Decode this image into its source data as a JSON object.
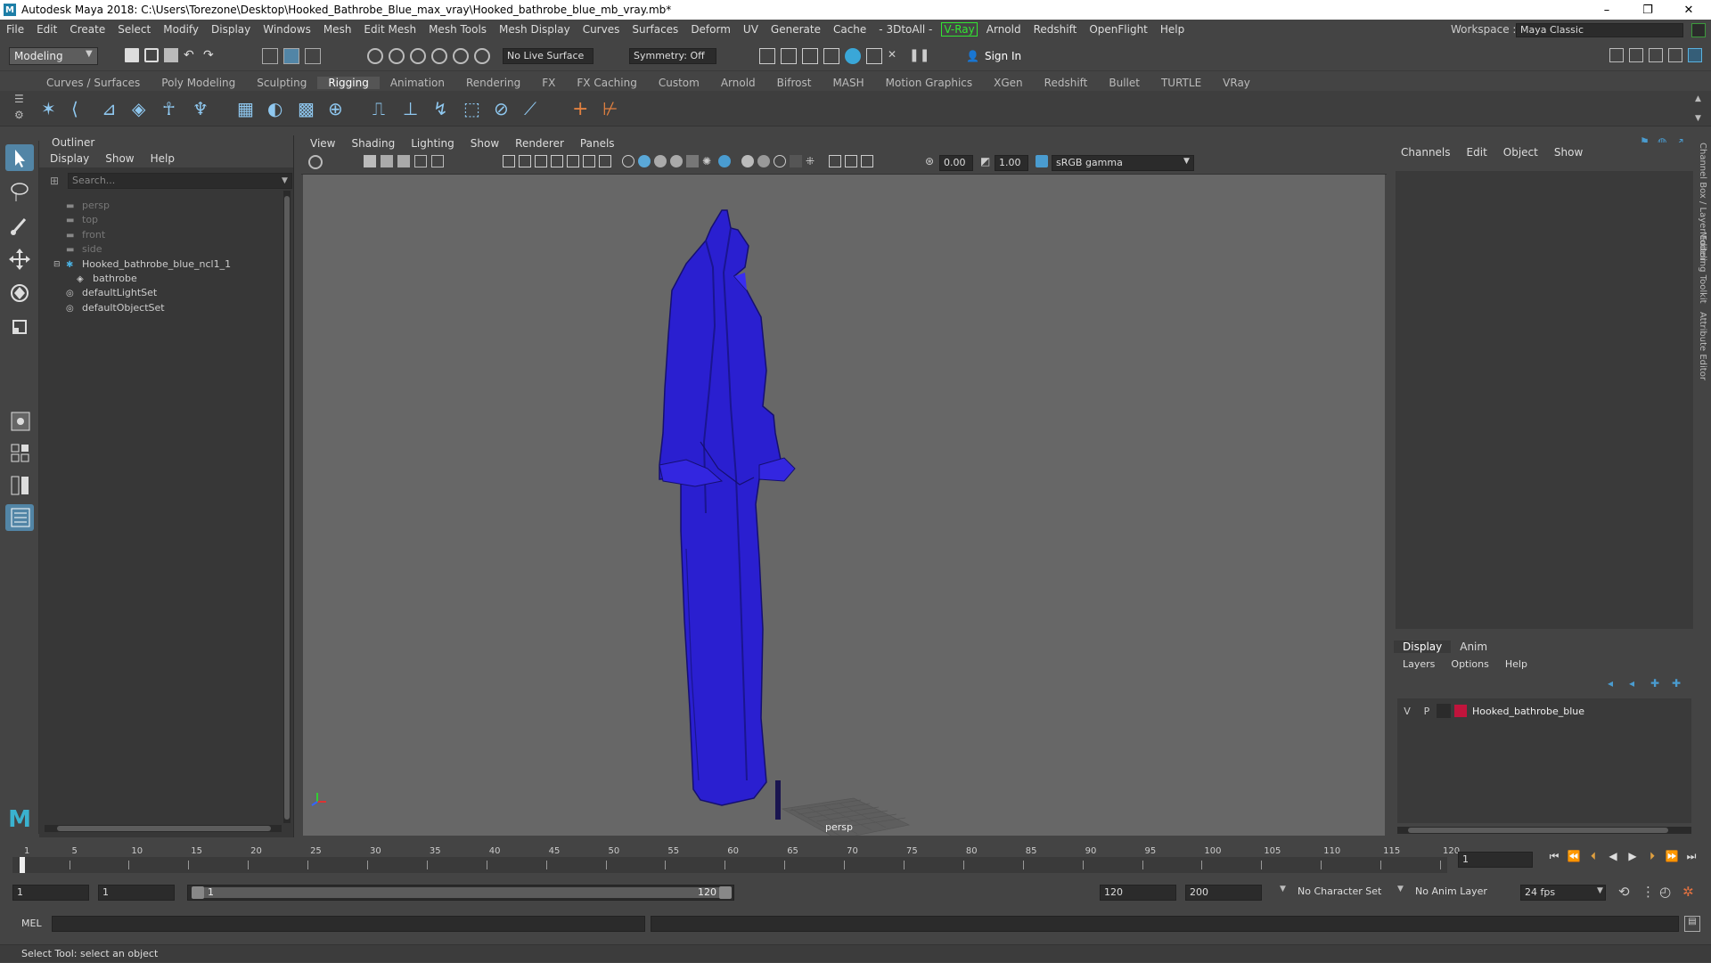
{
  "window": {
    "title": "Autodesk Maya 2018: C:\\Users\\Torezone\\Desktop\\Hooked_Bathrobe_Blue_max_vray\\Hooked_bathrobe_blue_mb_vray.mb*",
    "minimize": "–",
    "maximize": "❐",
    "close": "✕"
  },
  "menubar": {
    "items": [
      "File",
      "Edit",
      "Create",
      "Select",
      "Modify",
      "Display",
      "Windows",
      "Mesh",
      "Edit Mesh",
      "Mesh Tools",
      "Mesh Display",
      "Curves",
      "Surfaces",
      "Deform",
      "UV",
      "Generate",
      "Cache",
      "- 3DtoAll -"
    ],
    "vray": "V-Ray",
    "items2": [
      "Arnold",
      "Redshift",
      "OpenFlight",
      "Help"
    ],
    "workspace_label": "Workspace :",
    "workspace_value": "Maya Classic"
  },
  "statusline": {
    "mode": "Modeling",
    "live_surface": "No Live Surface",
    "symmetry": "Symmetry: Off",
    "sign_in": "Sign In"
  },
  "shelf": {
    "tabs": [
      "Curves / Surfaces",
      "Poly Modeling",
      "Sculpting",
      "Rigging",
      "Animation",
      "Rendering",
      "FX",
      "FX Caching",
      "Custom",
      "Arnold",
      "Bifrost",
      "MASH",
      "Motion Graphics",
      "XGen",
      "Redshift",
      "Bullet",
      "TURTLE",
      "VRay"
    ],
    "active_tab": "Rigging"
  },
  "outliner": {
    "title": "Outliner",
    "menu": [
      "Display",
      "Show",
      "Help"
    ],
    "search_placeholder": "Search...",
    "rows": [
      {
        "label": "persp",
        "icon": "camera-icon",
        "dim": true
      },
      {
        "label": "top",
        "icon": "camera-icon",
        "dim": true
      },
      {
        "label": "front",
        "icon": "camera-icon",
        "dim": true
      },
      {
        "label": "side",
        "icon": "camera-icon",
        "dim": true
      },
      {
        "label": "Hooked_bathrobe_blue_ncl1_1",
        "icon": "group-icon",
        "dim": false
      },
      {
        "label": "bathrobe",
        "icon": "mesh-icon",
        "dim": false
      },
      {
        "label": "defaultLightSet",
        "icon": "set-icon",
        "dim": false
      },
      {
        "label": "defaultObjectSet",
        "icon": "set-icon",
        "dim": false
      }
    ]
  },
  "viewport": {
    "menu": [
      "View",
      "Shading",
      "Lighting",
      "Show",
      "Renderer",
      "Panels"
    ],
    "exposure": "0.00",
    "gamma": "1.00",
    "color_space": "sRGB gamma",
    "camera_label": "persp",
    "robe_color": "#2a1fd0"
  },
  "channelbox": {
    "menu": [
      "Channels",
      "Edit",
      "Object",
      "Show"
    ]
  },
  "layers": {
    "tabs": [
      "Display",
      "Anim"
    ],
    "active_tab": "Display",
    "menu": [
      "Layers",
      "Options",
      "Help"
    ],
    "v": "V",
    "p": "P",
    "layer_name": "Hooked_bathrobe_blue",
    "layer_color": "#c0143c"
  },
  "side_tabs": [
    "Channel Box / Layer Editor",
    "Modeling Toolkit",
    "Attribute Editor"
  ],
  "timeslider": {
    "ticks": [
      "1",
      "5",
      "10",
      "15",
      "20",
      "25",
      "30",
      "35",
      "40",
      "45",
      "50",
      "55",
      "60",
      "65",
      "70",
      "75",
      "80",
      "85",
      "90",
      "95",
      "100",
      "105",
      "110",
      "115",
      "120"
    ],
    "current_frame": "1"
  },
  "range": {
    "start": "1",
    "playback_start": "1",
    "slider_start": "1",
    "slider_end": "120",
    "playback_end": "120",
    "end": "200",
    "character_set": "No Character Set",
    "anim_layer": "No Anim Layer",
    "fps": "24 fps"
  },
  "cmdline": {
    "label": "MEL"
  },
  "helpline": {
    "text": "Select Tool: select an object"
  }
}
